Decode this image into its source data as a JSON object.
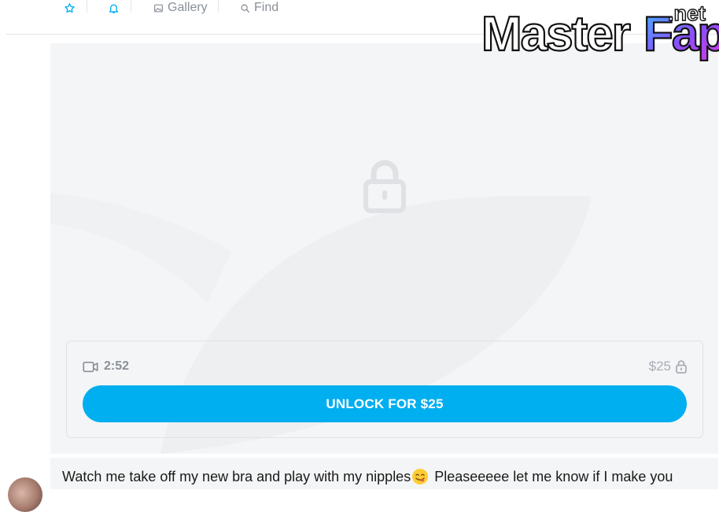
{
  "nav": {
    "items": [
      {
        "icon": "star-icon",
        "label": ""
      },
      {
        "icon": "bell-icon",
        "label": ""
      },
      {
        "icon": "image-icon",
        "label": "Gallery"
      },
      {
        "icon": "search-icon",
        "label": "Find"
      }
    ]
  },
  "watermark": {
    "text_main": "MasterFap",
    "text_tld": ".net"
  },
  "post": {
    "duration": "2:52",
    "price": "$25",
    "unlock_label": "UNLOCK FOR $25",
    "caption_before": "Watch me take off my new bra and play with my nipples",
    "caption_emoji": "face-savoring-food-emoji",
    "caption_after": " Pleaseeeee let me know if I make you"
  },
  "colors": {
    "accent": "#00aff0",
    "muted": "#8a9099",
    "placeholder_bg": "#f4f5f6"
  }
}
